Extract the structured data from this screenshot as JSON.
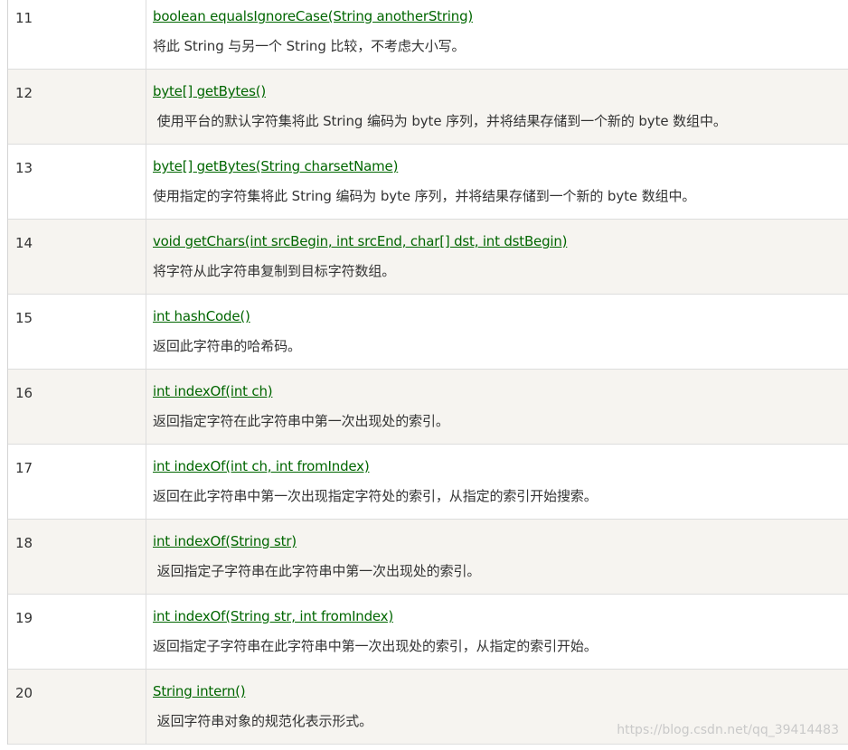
{
  "rows": [
    {
      "num": "11",
      "method": "boolean equalsIgnoreCase(String anotherString)",
      "desc": "将此 String 与另一个 String 比较，不考虑大小写。"
    },
    {
      "num": "12",
      "method": "byte[] getBytes()",
      "desc": " 使用平台的默认字符集将此 String 编码为 byte 序列，并将结果存储到一个新的 byte 数组中。"
    },
    {
      "num": "13",
      "method": "byte[] getBytes(String charsetName)",
      "desc": "使用指定的字符集将此 String 编码为 byte 序列，并将结果存储到一个新的 byte 数组中。"
    },
    {
      "num": "14",
      "method": "void getChars(int srcBegin, int srcEnd, char[] dst, int dstBegin)",
      "desc": "将字符从此字符串复制到目标字符数组。"
    },
    {
      "num": "15",
      "method": "int hashCode()",
      "desc": "返回此字符串的哈希码。"
    },
    {
      "num": "16",
      "method": "int indexOf(int ch)",
      "desc": "返回指定字符在此字符串中第一次出现处的索引。"
    },
    {
      "num": "17",
      "method": "int indexOf(int ch, int fromIndex)",
      "desc": "返回在此字符串中第一次出现指定字符处的索引，从指定的索引开始搜索。"
    },
    {
      "num": "18",
      "method": "int indexOf(String str)",
      "desc": " 返回指定子字符串在此字符串中第一次出现处的索引。"
    },
    {
      "num": "19",
      "method": "int indexOf(String str, int fromIndex)",
      "desc": "返回指定子字符串在此字符串中第一次出现处的索引，从指定的索引开始。"
    },
    {
      "num": "20",
      "method": "String intern()",
      "desc": " 返回字符串对象的规范化表示形式。"
    }
  ],
  "watermark": "https://blog.csdn.net/qq_39414483"
}
